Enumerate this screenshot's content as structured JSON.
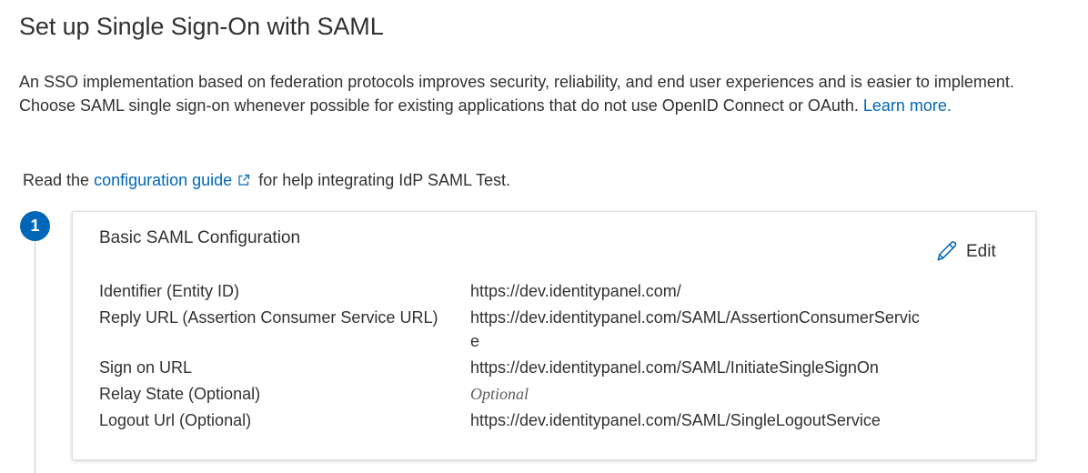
{
  "page": {
    "title": "Set up Single Sign-On with SAML",
    "intro_text": "An SSO implementation based on federation protocols improves security, reliability, and end user experiences and is easier to implement. Choose SAML single sign-on whenever possible for existing applications that do not use OpenID Connect or OAuth. ",
    "intro_link": "Learn more.",
    "guide_prefix": "Read the ",
    "guide_link": "configuration guide",
    "guide_suffix": " for help integrating IdP SAML Test."
  },
  "step": {
    "number": "1",
    "card_title": "Basic SAML Configuration",
    "edit_label": "Edit",
    "properties": [
      {
        "label": "Identifier (Entity ID)",
        "value": "https://dev.identitypanel.com/"
      },
      {
        "label": "Reply URL (Assertion Consumer Service URL)",
        "value": "https://dev.identitypanel.com/SAML/AssertionConsumerService"
      },
      {
        "label": "Sign on URL",
        "value": "https://dev.identitypanel.com/SAML/InitiateSingleSignOn"
      },
      {
        "label": "Relay State (Optional)",
        "value": "Optional"
      },
      {
        "label": "Logout Url (Optional)",
        "value": "https://dev.identitypanel.com/SAML/SingleLogoutService"
      }
    ]
  },
  "icons": {
    "external_link": "external-link-icon",
    "edit": "pencil-icon"
  },
  "colors": {
    "accent": "#0067b8",
    "text": "#323130",
    "placeholder": "#605e5c"
  }
}
